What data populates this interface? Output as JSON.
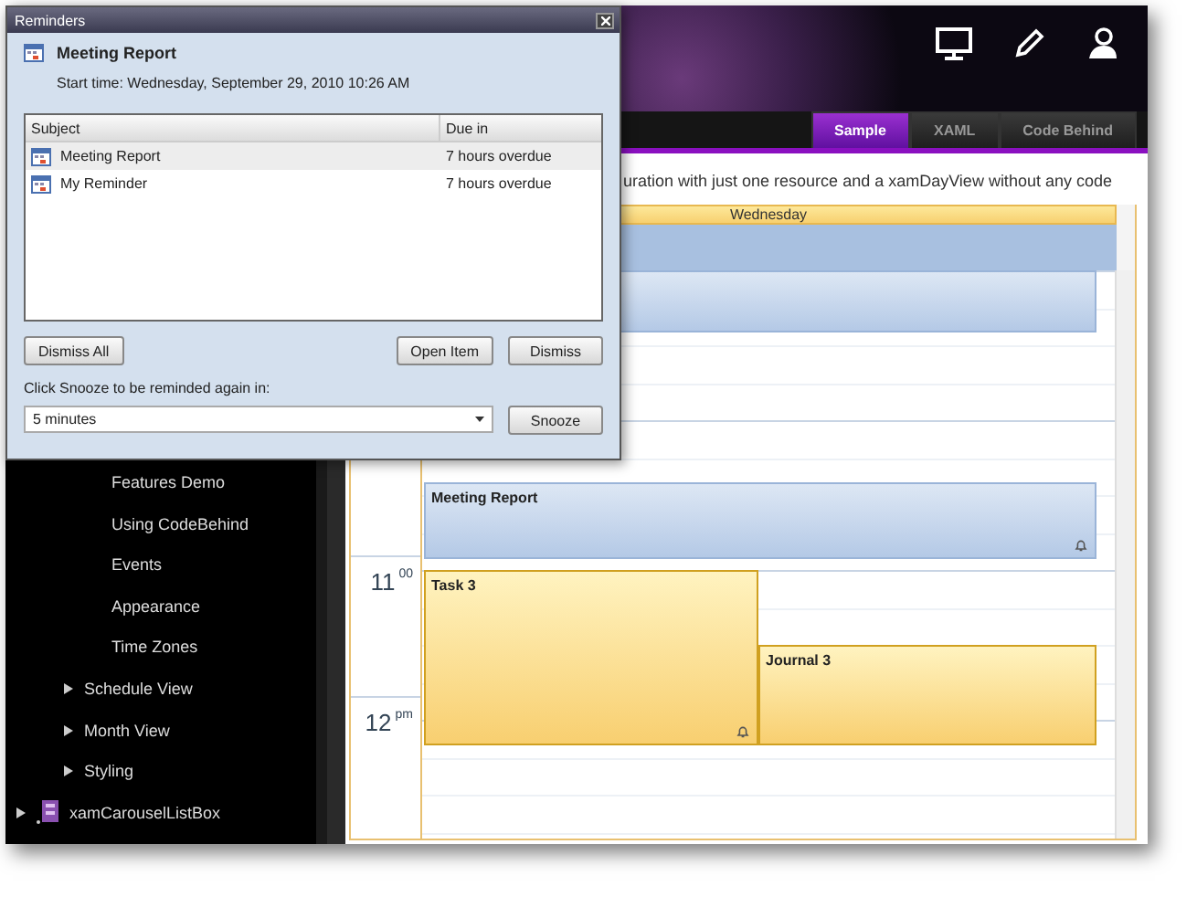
{
  "dialog": {
    "title": "Reminders",
    "subject": "Meeting Report",
    "start_time": "Start time: Wednesday, September 29, 2010 10:26 AM",
    "columns": [
      "Subject",
      "Due in"
    ],
    "reminders": [
      {
        "subject": "Meeting Report",
        "due": "7 hours overdue",
        "selected": true
      },
      {
        "subject": "My Reminder",
        "due": "7 hours overdue",
        "selected": false
      }
    ],
    "dismiss_all": "Dismiss All",
    "open_item": "Open Item",
    "dismiss": "Dismiss",
    "snooze_label": "Click Snooze to be reminded again in:",
    "snooze_value": "5 minutes",
    "snooze_button": "Snooze"
  },
  "tabs": [
    {
      "label": "Sample",
      "selected": true
    },
    {
      "label": "XAML",
      "selected": false
    },
    {
      "label": "Code Behind",
      "selected": false
    }
  ],
  "sidebar": {
    "tree": [
      {
        "children": [
          {
            "children": [
              {
                "label": "Features Demo"
              },
              {
                "label": "Using CodeBehind"
              },
              {
                "label": "Events"
              },
              {
                "label": "Appearance"
              },
              {
                "label": "Time Zones"
              }
            ]
          },
          {
            "label": "Schedule View",
            "expanded": false
          },
          {
            "label": "Month View",
            "expanded": false
          },
          {
            "label": "Styling",
            "expanded": false
          }
        ]
      },
      {
        "label": "xamCarouselListBox",
        "expanded": false,
        "kind": "product"
      }
    ]
  },
  "description": "uration with just one resource and a xamDayView without any code",
  "day_view": {
    "day": "Wednesday",
    "times": [
      {
        "hour": "11",
        "suffix": "00"
      },
      {
        "hour": "12",
        "suffix": "pm"
      }
    ],
    "appointments": [
      {
        "kind": "appointment"
      },
      {
        "kind": "appointment",
        "title": "Meeting Report",
        "reminder": true
      },
      {
        "kind": "task",
        "title": "Task 3",
        "reminder": true
      },
      {
        "kind": "journal",
        "title": "Journal 3",
        "reminder": false
      }
    ]
  }
}
